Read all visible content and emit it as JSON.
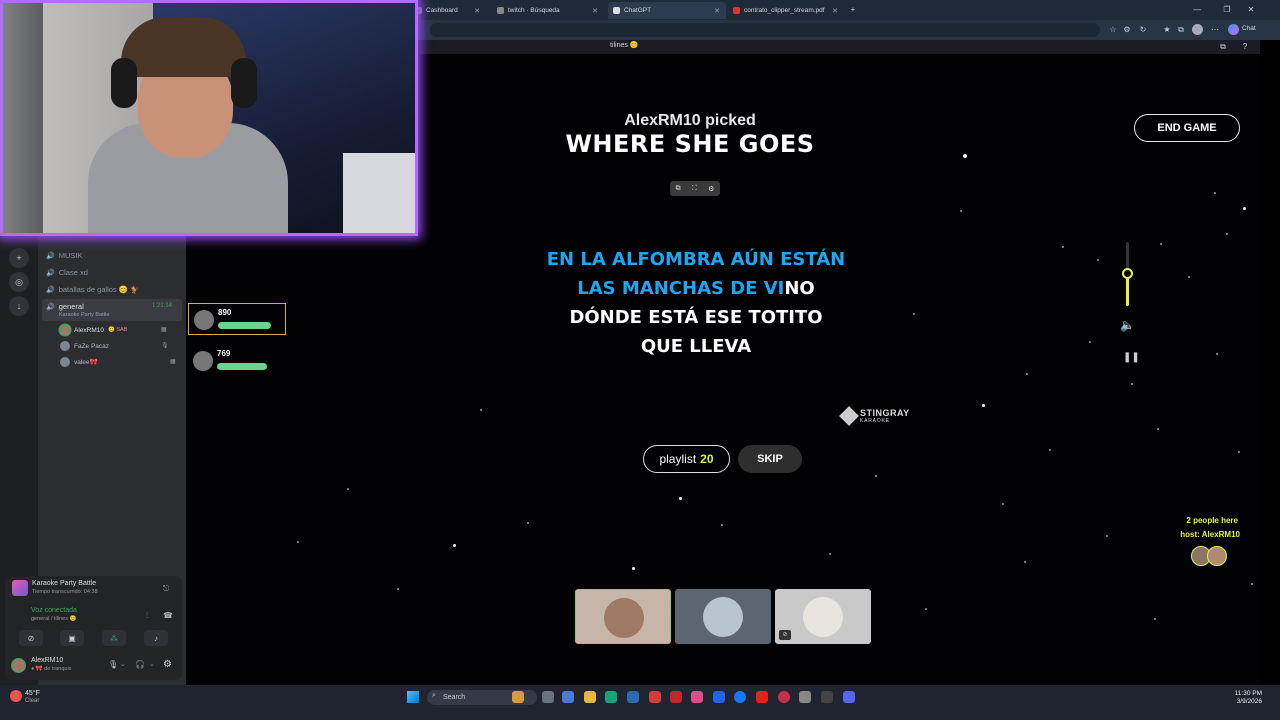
{
  "browser": {
    "tabs": [
      {
        "label": "Cashboard"
      },
      {
        "label": "twitch · Búsqueda"
      },
      {
        "label": "ChatGPT"
      },
      {
        "label": "contrato_clipper_stream.pdf"
      }
    ],
    "new_tab": "+",
    "copilot_label": "Chat"
  },
  "discord": {
    "channel_title": "tilines 😊",
    "channels": [
      {
        "label": "MUSIK"
      },
      {
        "label": "Clase xd"
      },
      {
        "label": "batallas de gallos 😊 🐓"
      }
    ],
    "active_channel": {
      "label": "general",
      "sub": "Karaoke Party Battle",
      "time": "1:21:14"
    },
    "members": [
      {
        "name": "AlexRM10",
        "badge": "😊 SAB"
      },
      {
        "name": "FaZe Pacaz",
        "badge": ""
      },
      {
        "name": "valee🎀",
        "badge": ""
      }
    ],
    "activity": {
      "title": "Karaoke Party Battle",
      "elapsed": "Tiempo transcurrido: 04:38"
    },
    "voice": {
      "status": "Voz conectada",
      "location": "general / tilines 😊"
    },
    "user": {
      "name": "AlexRM10",
      "status": "● 🎀 de tranquis"
    }
  },
  "scores": [
    {
      "value": "890",
      "progress": 0.98
    },
    {
      "value": "769",
      "progress": 0.92
    }
  ],
  "game": {
    "picker": "AlexRM10 picked",
    "song": "WHERE SHE GOES",
    "end_button": "END GAME",
    "lyrics": [
      {
        "sung": "EN LA ALFOMBRA AÚN ESTÁN",
        "unsung": ""
      },
      {
        "sung": "LAS MANCHAS DE VI",
        "unsung": "NO"
      },
      {
        "sung": "",
        "unsung": "DÓNDE ESTÁ ESE TOTITO"
      },
      {
        "sung": "",
        "unsung": "QUE LLEVA"
      }
    ],
    "brand_name": "STINGRAY",
    "brand_sub": "KARAOKE",
    "playlist_label": "playlist",
    "playlist_count": "20",
    "skip_label": "SKIP",
    "volume_level": 0.5,
    "people_here": "2 people here",
    "host": "host: AlexRM10"
  },
  "taskbar": {
    "weather_temp": "45°F",
    "weather_cond": "Clear",
    "search_placeholder": "Search",
    "time": "11:30 PM",
    "date": "3/9/2026"
  },
  "colors": {
    "lyric_sung": "#1ea6f0",
    "accent_yellow": "#e4f14a",
    "score_bar": "#6ad38c",
    "webcam_glow": "#9c4dff",
    "voice_green": "#3ba55c"
  }
}
